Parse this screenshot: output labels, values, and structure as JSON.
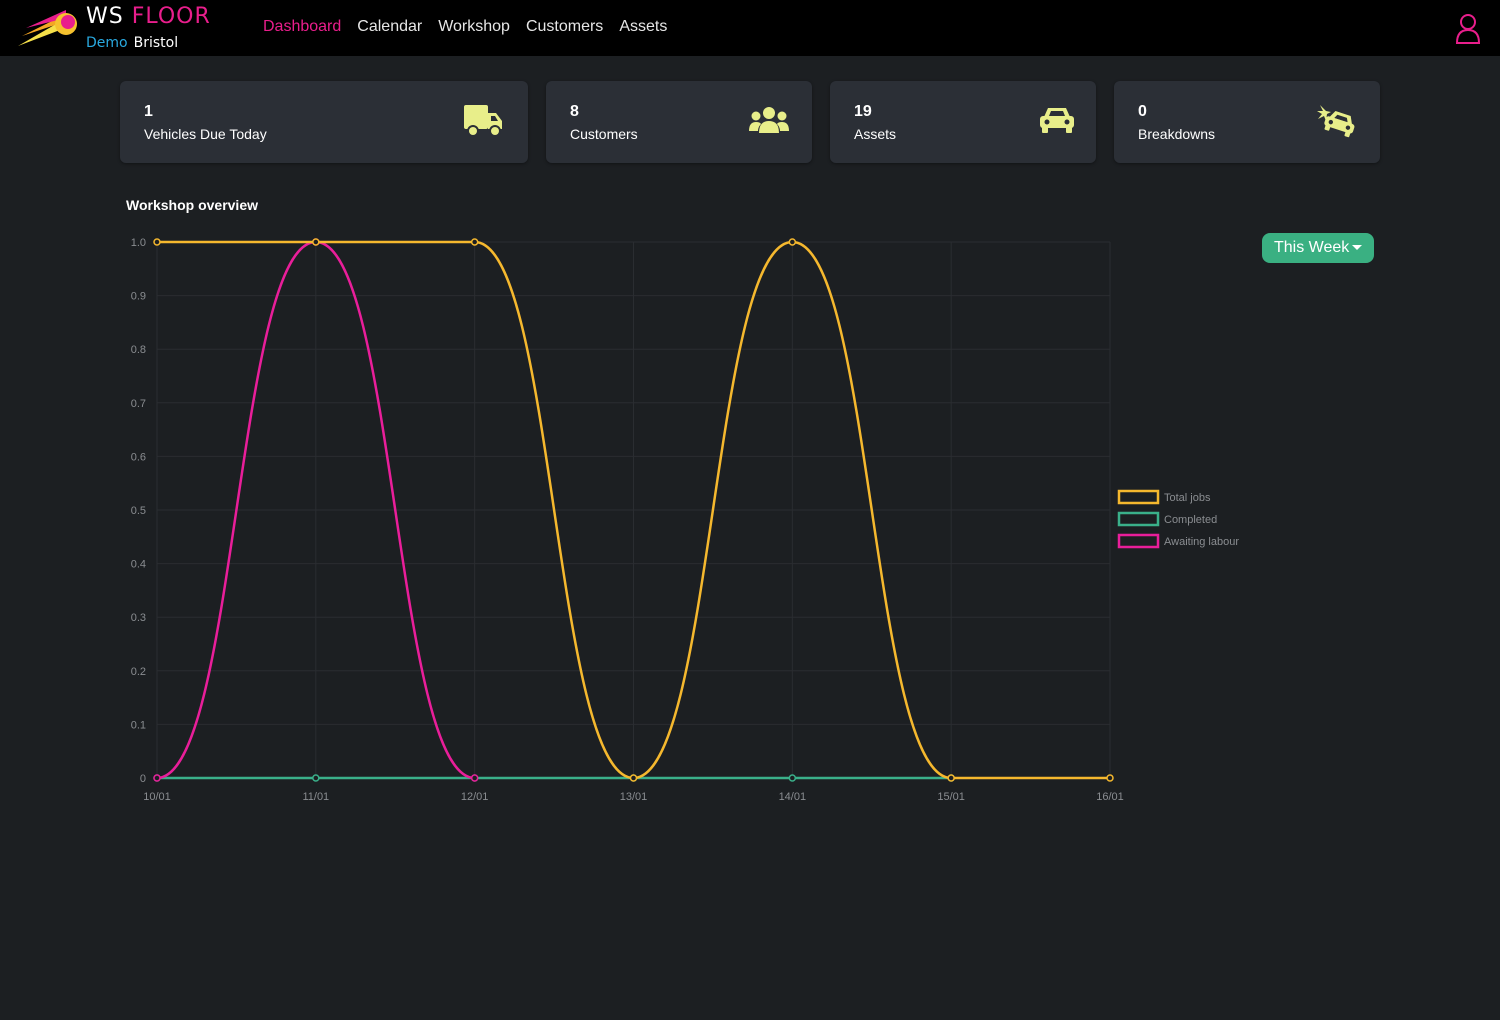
{
  "brand": {
    "ws": "WS",
    "floor": "FLOOR",
    "demo": "Demo",
    "branch": "Bristol"
  },
  "nav": [
    {
      "label": "Dashboard",
      "active": true
    },
    {
      "label": "Calendar",
      "active": false
    },
    {
      "label": "Workshop",
      "active": false
    },
    {
      "label": "Customers",
      "active": false
    },
    {
      "label": "Assets",
      "active": false
    }
  ],
  "user_icon": "user-icon",
  "cards": [
    {
      "value": "1",
      "label": "Vehicles Due Today",
      "icon": "truck-icon"
    },
    {
      "value": "8",
      "label": "Customers",
      "icon": "users-icon"
    },
    {
      "value": "19",
      "label": "Assets",
      "icon": "car-icon"
    },
    {
      "value": "0",
      "label": "Breakdowns",
      "icon": "car-crash-icon"
    }
  ],
  "section_title": "Workshop overview",
  "range_button": "This Week",
  "colors": {
    "accent_pink": "#e91e8c",
    "accent_blue": "#29a9e0",
    "card_icon": "#e8ee8a",
    "button_green": "#3ab082",
    "series_total": "#f5b82e",
    "series_completed": "#3ab08a",
    "series_awaiting": "#e91e9a"
  },
  "chart_data": {
    "type": "line",
    "title": "",
    "x": [
      "10/01",
      "11/01",
      "12/01",
      "13/01",
      "14/01",
      "15/01",
      "16/01"
    ],
    "ylim": [
      0,
      1
    ],
    "yticks": [
      "0",
      "0.1",
      "0.2",
      "0.3",
      "0.4",
      "0.5",
      "0.6",
      "0.7",
      "0.8",
      "0.9",
      "1.0"
    ],
    "grid": true,
    "legend_position": "right",
    "series": [
      {
        "name": "Total jobs",
        "values": [
          1,
          1,
          1,
          0,
          1,
          0,
          0
        ]
      },
      {
        "name": "Completed",
        "values": [
          0,
          0,
          0,
          0,
          0,
          0,
          null
        ]
      },
      {
        "name": "Awaiting labour",
        "values": [
          0,
          1,
          0,
          null,
          null,
          null,
          null
        ]
      }
    ]
  }
}
